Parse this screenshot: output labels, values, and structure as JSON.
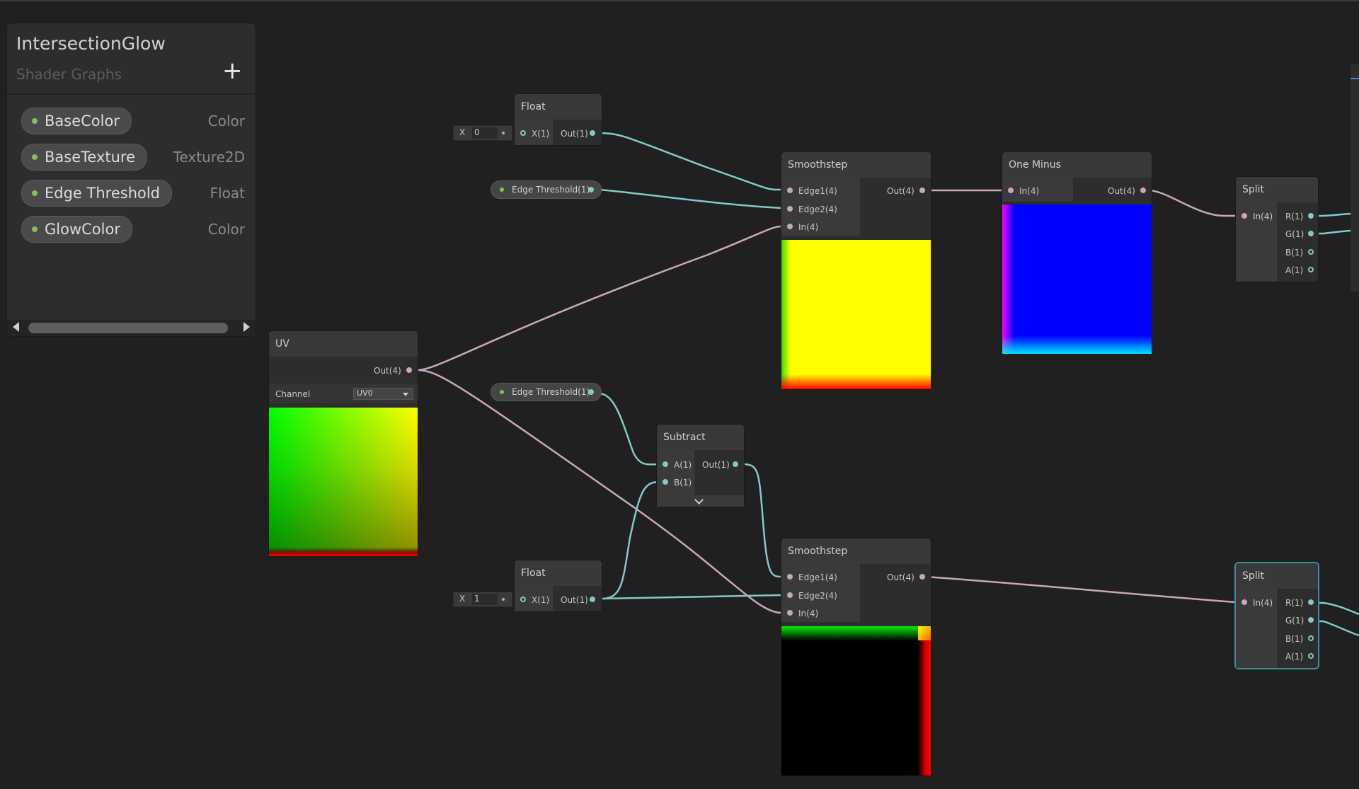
{
  "blackboard": {
    "title": "IntersectionGlow",
    "subtitle": "Shader Graphs",
    "add_icon": "+",
    "properties": [
      {
        "name": "BaseColor",
        "type": "Color"
      },
      {
        "name": "BaseTexture",
        "type": "Texture2D"
      },
      {
        "name": "Edge Threshold",
        "type": "Float"
      },
      {
        "name": "GlowColor",
        "type": "Color"
      }
    ]
  },
  "nodes": {
    "float_top": {
      "title": "Float",
      "x_label": "X",
      "x_value": "0",
      "in_port": "X(1)",
      "out_port": "Out(1)"
    },
    "float_bottom": {
      "title": "Float",
      "x_label": "X",
      "x_value": "1",
      "in_port": "X(1)",
      "out_port": "Out(1)"
    },
    "edge_threshold_top": {
      "label": "Edge Threshold(1)"
    },
    "edge_threshold_bottom": {
      "label": "Edge Threshold(1)"
    },
    "uv": {
      "title": "UV",
      "out_port": "Out(4)",
      "channel_label": "Channel",
      "channel_value": "UV0"
    },
    "smoothstep_top": {
      "title": "Smoothstep",
      "in_ports": [
        "Edge1(4)",
        "Edge2(4)",
        "In(4)"
      ],
      "out_port": "Out(4)"
    },
    "smoothstep_bottom": {
      "title": "Smoothstep",
      "in_ports": [
        "Edge1(4)",
        "Edge2(4)",
        "In(4)"
      ],
      "out_port": "Out(4)"
    },
    "one_minus": {
      "title": "One Minus",
      "in_port": "In(4)",
      "out_port": "Out(4)"
    },
    "subtract": {
      "title": "Subtract",
      "in_ports": [
        "A(1)",
        "B(1)"
      ],
      "out_port": "Out(1)"
    },
    "split_top": {
      "title": "Split",
      "in_port": "In(4)",
      "out_ports": [
        "R(1)",
        "G(1)",
        "B(1)",
        "A(1)"
      ]
    },
    "split_bottom": {
      "title": "Split",
      "in_port": "In(4)",
      "out_ports": [
        "R(1)",
        "G(1)",
        "B(1)",
        "A(1)"
      ]
    }
  },
  "icons": [
    "plus-icon",
    "scroll-left-arrow-icon",
    "scroll-right-arrow-icon",
    "dropdown-caret-icon",
    "chevron-down-icon"
  ],
  "colors": {
    "canvas": "#202020",
    "node_body": "#2d2d2d",
    "node_header": "#393939",
    "float_wire": "#83c9c9",
    "vector_wire": "#cba5c0",
    "property_dot": "#7ec35a",
    "selection": "#3a8ea0"
  }
}
